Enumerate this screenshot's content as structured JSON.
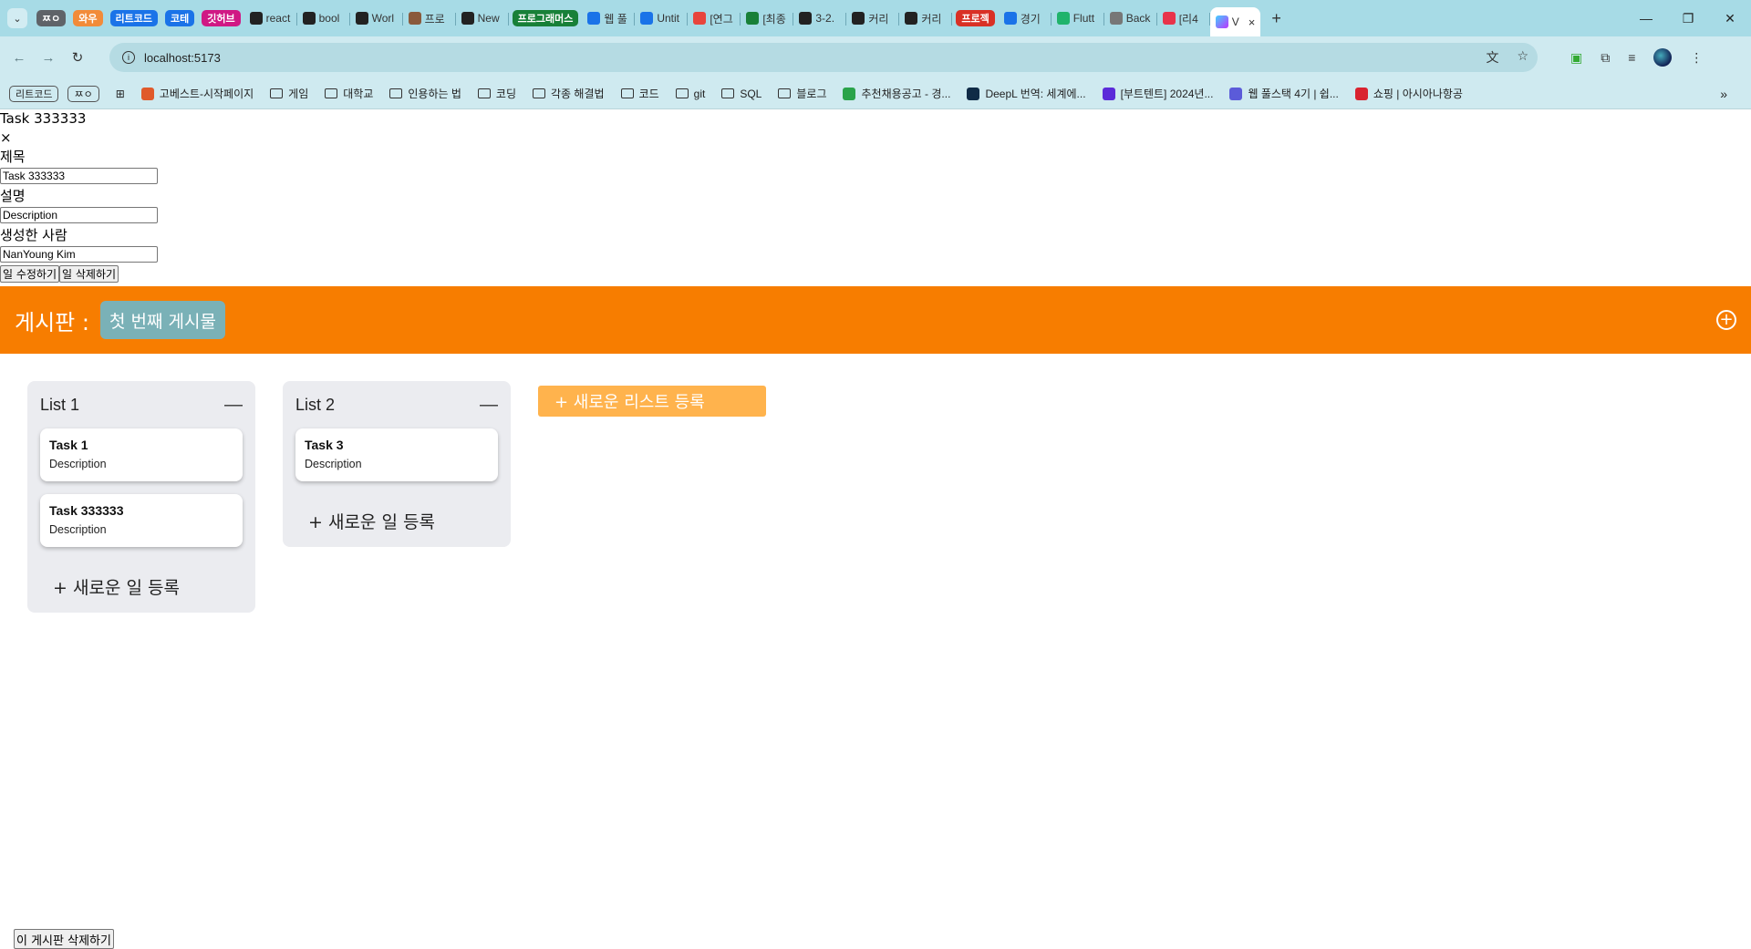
{
  "browser": {
    "tab_groups": [
      {
        "label": "ㅉㅇ",
        "color": "#5f6368"
      },
      {
        "label": "와우",
        "color": "#f28b39"
      },
      {
        "label": "리트코드",
        "color": "#1a73e8"
      },
      {
        "label": "코테",
        "color": "#1a73e8"
      },
      {
        "label": "깃허브",
        "color": "#d01884"
      }
    ],
    "tabs_a": [
      {
        "label": "react",
        "icon_color": "#222222"
      },
      {
        "label": "bool",
        "icon_color": "#222222"
      },
      {
        "label": "Worl",
        "icon_color": "#222222"
      },
      {
        "label": "프로",
        "icon_color": "#8a5a3c"
      },
      {
        "label": "New",
        "icon_color": "#222222"
      }
    ],
    "group_programmers": {
      "label": "프로그래머스",
      "color": "#188038"
    },
    "tabs_b": [
      {
        "label": "웹 풀",
        "icon_color": "#1a73e8"
      },
      {
        "label": "Untit",
        "icon_color": "#1a73e8"
      },
      {
        "label": "[연그",
        "icon_color": "#e8453c"
      },
      {
        "label": "[최종",
        "icon_color": "#188038"
      },
      {
        "label": "3-2.",
        "icon_color": "#222222"
      },
      {
        "label": "커리",
        "icon_color": "#222222"
      },
      {
        "label": "커리",
        "icon_color": "#222222"
      }
    ],
    "group_project": {
      "label": "프로젝",
      "color": "#d93025"
    },
    "tabs_c": [
      {
        "label": "경기",
        "icon_color": "#1a73e8"
      },
      {
        "label": "Flutt",
        "icon_color": "#20b36b"
      },
      {
        "label": "Back",
        "icon_color": "#777777"
      },
      {
        "label": "[리4",
        "icon_color": "#e8334a"
      }
    ],
    "active_tab": {
      "label": "V",
      "close": "×"
    },
    "new_tab": "+",
    "window_controls": {
      "minimize": "—",
      "restore": "❐",
      "close": "✕"
    },
    "url": "localhost:5173",
    "bookmark_groups": [
      {
        "label": "리트코드"
      },
      {
        "label": "ㅉㅇ"
      }
    ],
    "bookmarks": [
      {
        "label": "고베스트-시작페이지",
        "type": "fav",
        "color": "#e05a2b"
      },
      {
        "label": "게임",
        "type": "folder"
      },
      {
        "label": "대학교",
        "type": "folder"
      },
      {
        "label": "인용하는 법",
        "type": "folder"
      },
      {
        "label": "코딩",
        "type": "folder"
      },
      {
        "label": "각종 해결법",
        "type": "folder"
      },
      {
        "label": "코드",
        "type": "folder"
      },
      {
        "label": "git",
        "type": "folder"
      },
      {
        "label": "SQL",
        "type": "folder"
      },
      {
        "label": "블로그",
        "type": "folder"
      },
      {
        "label": "추천채용공고 - 경...",
        "type": "fav",
        "color": "#2aa34a"
      },
      {
        "label": "DeepL 번역: 세계에...",
        "type": "fav",
        "color": "#0f2b46"
      },
      {
        "label": "[부트텐트] 2024년...",
        "type": "fav",
        "color": "#5b2bd9"
      },
      {
        "label": "웹 풀스택 4기 | 쉽...",
        "type": "fav",
        "color": "#5b5bd9"
      },
      {
        "label": "쇼핑 | 아시아나항공",
        "type": "fav",
        "color": "#d9232f"
      }
    ],
    "bookmarks_more": "»"
  },
  "modal": {
    "heading": "Task 333333",
    "close": "×",
    "title_label": "제목",
    "title_value": "Task 333333",
    "desc_label": "설명",
    "desc_value": "Description",
    "author_label": "생성한 사람",
    "author_value": "NanYoung Kim",
    "update_button": "일 수정하기",
    "delete_button": "일 삭제하기"
  },
  "board": {
    "title": "게시판 :",
    "chip": "첫 번째 게시물",
    "add_icon": "+",
    "header_color": "#f77d00",
    "chip_color": "#7ab1b7"
  },
  "lists": [
    {
      "title": "List 1",
      "collapse": "—",
      "cards": [
        {
          "title": "Task 1",
          "description": "Description"
        },
        {
          "title": "Task 333333",
          "description": "Description"
        }
      ],
      "add_task": "+ 새로운 일 등록"
    },
    {
      "title": "List 2",
      "collapse": "—",
      "cards": [
        {
          "title": "Task 3",
          "description": "Description"
        }
      ],
      "add_task": "+ 새로운 일 등록"
    }
  ],
  "add_list": "+ 새로운 리스트 등록",
  "delete_board": "이 게시판 삭제하기"
}
